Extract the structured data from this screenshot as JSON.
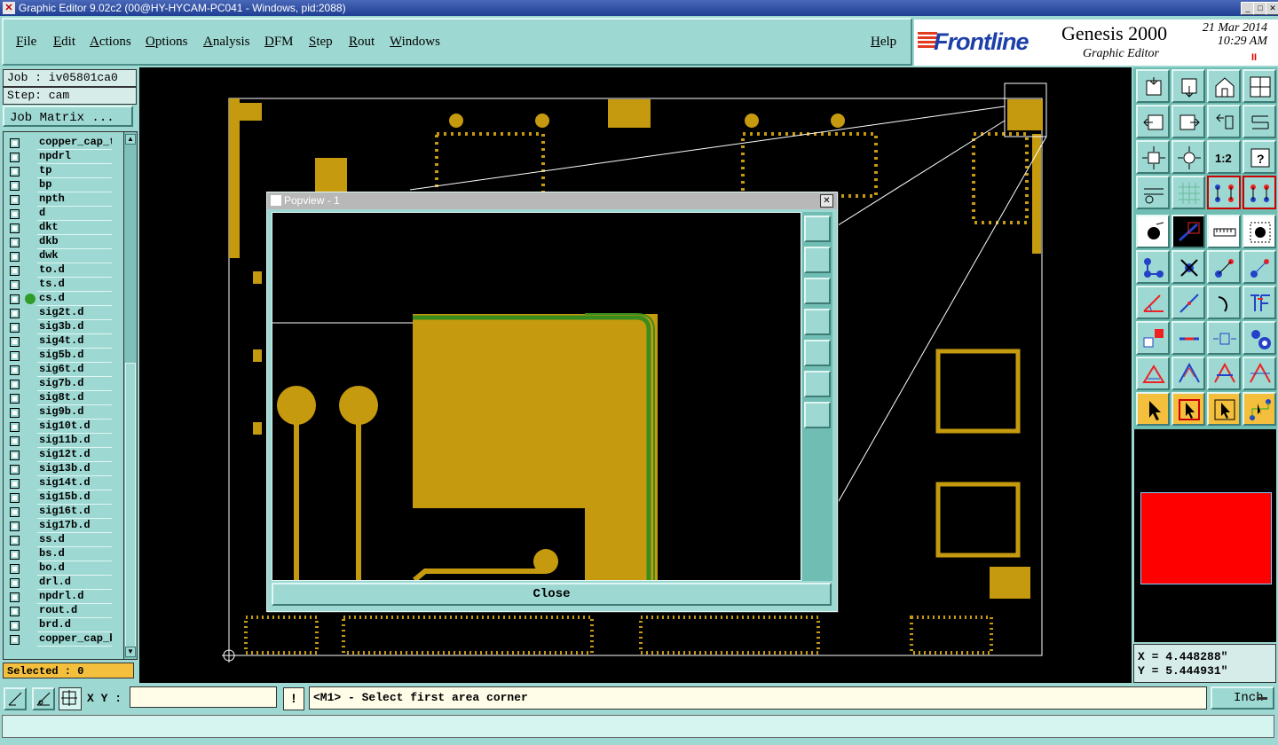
{
  "window": {
    "title": "Graphic Editor 9.02c2 (00@HY-HYCAM-PC041 - Windows, pid:2088)"
  },
  "menu": {
    "items": [
      "File",
      "Edit",
      "Actions",
      "Options",
      "Analysis",
      "DFM",
      "Step",
      "Rout",
      "Windows"
    ],
    "help": "Help"
  },
  "logo": {
    "brand": "Frontline",
    "product": "Genesis 2000",
    "module": "Graphic Editor",
    "date": "21 Mar 2014",
    "time": "10:29 AM",
    "pause_glyph": "II"
  },
  "left_panel": {
    "job": "Job : iv05801ca0",
    "step": "Step: cam",
    "job_matrix_button": "Job Matrix ...",
    "layers": [
      "copper_cap_t",
      "npdrl",
      "tp",
      "bp",
      "npth",
      "d",
      "dkt",
      "dkb",
      "dwk",
      "to.d",
      "ts.d",
      "cs.d",
      "sig2t.d",
      "sig3b.d",
      "sig4t.d",
      "sig5b.d",
      "sig6t.d",
      "sig7b.d",
      "sig8t.d",
      "sig9b.d",
      "sig10t.d",
      "sig11b.d",
      "sig12t.d",
      "sig13b.d",
      "sig14t.d",
      "sig15b.d",
      "sig16t.d",
      "sig17b.d",
      "ss.d",
      "bs.d",
      "bo.d",
      "drl.d",
      "npdrl.d",
      "rout.d",
      "brd.d",
      "copper_cap_b"
    ],
    "active_layer": "cs.d",
    "selected": "Selected : 0"
  },
  "popview": {
    "title": "Popview - 1",
    "close_label": "Close",
    "close_glyph": "✕"
  },
  "coords": {
    "x": "X = 4.448288\"",
    "y": "Y = 5.444931\""
  },
  "bottom": {
    "xy_label": "X Y :",
    "xy_value": "",
    "warn_glyph": "!",
    "prompt": "<M1> - Select first area corner",
    "units": "Inch"
  },
  "colors": {
    "copper": "#c69a0f",
    "panel": "#9ed8d2",
    "accent_red": "#ff0000",
    "canvas": "#000000",
    "selected_bg": "#f4bf3c"
  },
  "right_tools": {
    "row1": [
      "zoom-home-icon",
      "zoom-window-icon",
      "home-icon",
      "split-view-icon"
    ],
    "row2": [
      "pan-left-icon",
      "pan-right-icon",
      "undo-view-icon",
      "redo-view-icon"
    ],
    "row3": [
      "zoom-fit-icon",
      "zoom-center-icon",
      "zoom-1to1-icon",
      "query-icon"
    ],
    "row4": [
      "snap-settings-icon",
      "grid-icon",
      "net-a-icon",
      "net-b-icon"
    ]
  }
}
